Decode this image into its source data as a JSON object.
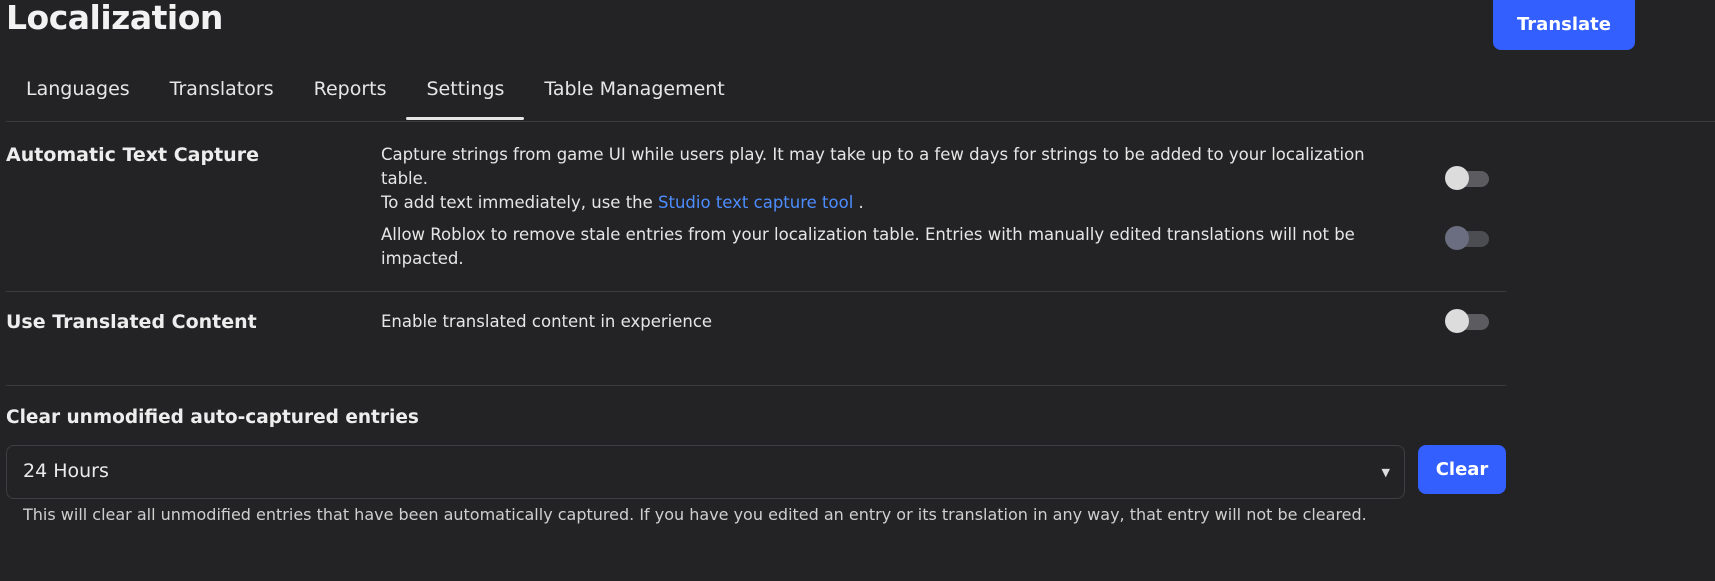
{
  "header": {
    "title": "Localization",
    "primary_button": "Translate"
  },
  "tabs": [
    {
      "label": "Languages",
      "active": false
    },
    {
      "label": "Translators",
      "active": false
    },
    {
      "label": "Reports",
      "active": false
    },
    {
      "label": "Settings",
      "active": true
    },
    {
      "label": "Table Management",
      "active": false
    }
  ],
  "automatic_text_capture": {
    "title": "Automatic Text Capture",
    "capture_line1": "Capture strings from game UI while users play. It may take up to a few days for strings to be added to your localization table.",
    "capture_line2_prefix": "To add text immediately, use the",
    "capture_link": "Studio text capture tool",
    "capture_line2_suffix": ".",
    "capture_toggle_on": false,
    "stale_text": "Allow Roblox to remove stale entries from your localization table. Entries with manually edited translations will not be impacted.",
    "stale_toggle_on": false
  },
  "translated_content": {
    "title": "Use Translated Content",
    "description": "Enable translated content in experience",
    "toggle_on": false
  },
  "clear_entries": {
    "title": "Clear unmodified auto-captured entries",
    "selected_option": "24 Hours",
    "button": "Clear",
    "help_text": "This will clear all unmodified entries that have been automatically captured. If you have you edited an entry or its translation in any way, that entry will not be cleared."
  },
  "colors": {
    "background": "#232325",
    "accent": "#335fff",
    "link": "#4d8dff"
  }
}
